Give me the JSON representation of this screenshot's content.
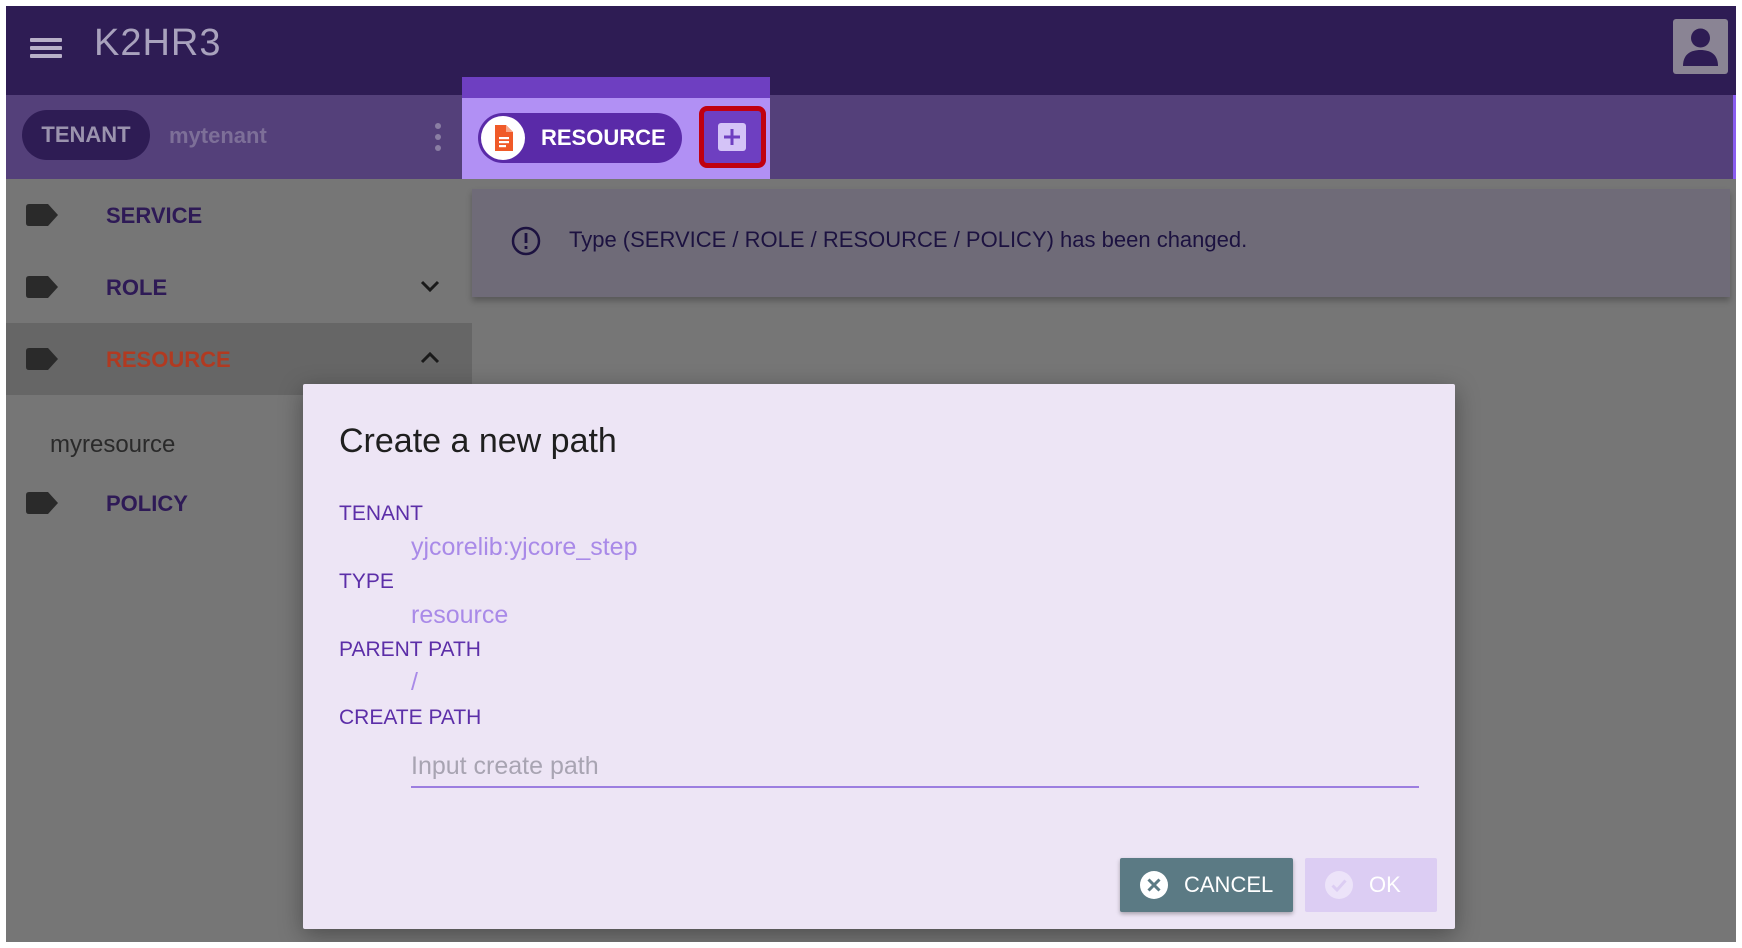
{
  "app": {
    "title": "K2HR3"
  },
  "icons": {
    "menu": "menu-icon",
    "account": "account-icon",
    "tag": "tag-icon",
    "resource": "document-icon",
    "add": "plus-icon",
    "info": "info-circle-icon",
    "cancel": "close-circle-icon",
    "ok": "check-circle-icon"
  },
  "colors": {
    "appbar": "#2e1c54",
    "accent": "#6e3fc1",
    "highlight_border": "#c00010",
    "active_nav_text": "#b13a21"
  },
  "subbar": {
    "tenant_chip": "TENANT",
    "tenant_name": "mytenant",
    "resource_chip": "RESOURCE"
  },
  "sidebar": {
    "items": [
      {
        "label": "SERVICE"
      },
      {
        "label": "ROLE"
      },
      {
        "label": "RESOURCE"
      },
      {
        "label": "POLICY"
      }
    ],
    "resource_children": [
      "myresource"
    ]
  },
  "notice": {
    "text": "Type (SERVICE / ROLE / RESOURCE / POLICY) has been changed."
  },
  "dialog": {
    "title": "Create a new path",
    "tenant_label": "TENANT",
    "tenant_value": "yjcorelib:yjcore_step",
    "type_label": "TYPE",
    "type_value": "resource",
    "parent_label": "PARENT PATH",
    "parent_value": "/",
    "create_label": "CREATE PATH",
    "create_placeholder": "Input create path",
    "create_value": "",
    "cancel_label": "CANCEL",
    "ok_label": "OK"
  }
}
